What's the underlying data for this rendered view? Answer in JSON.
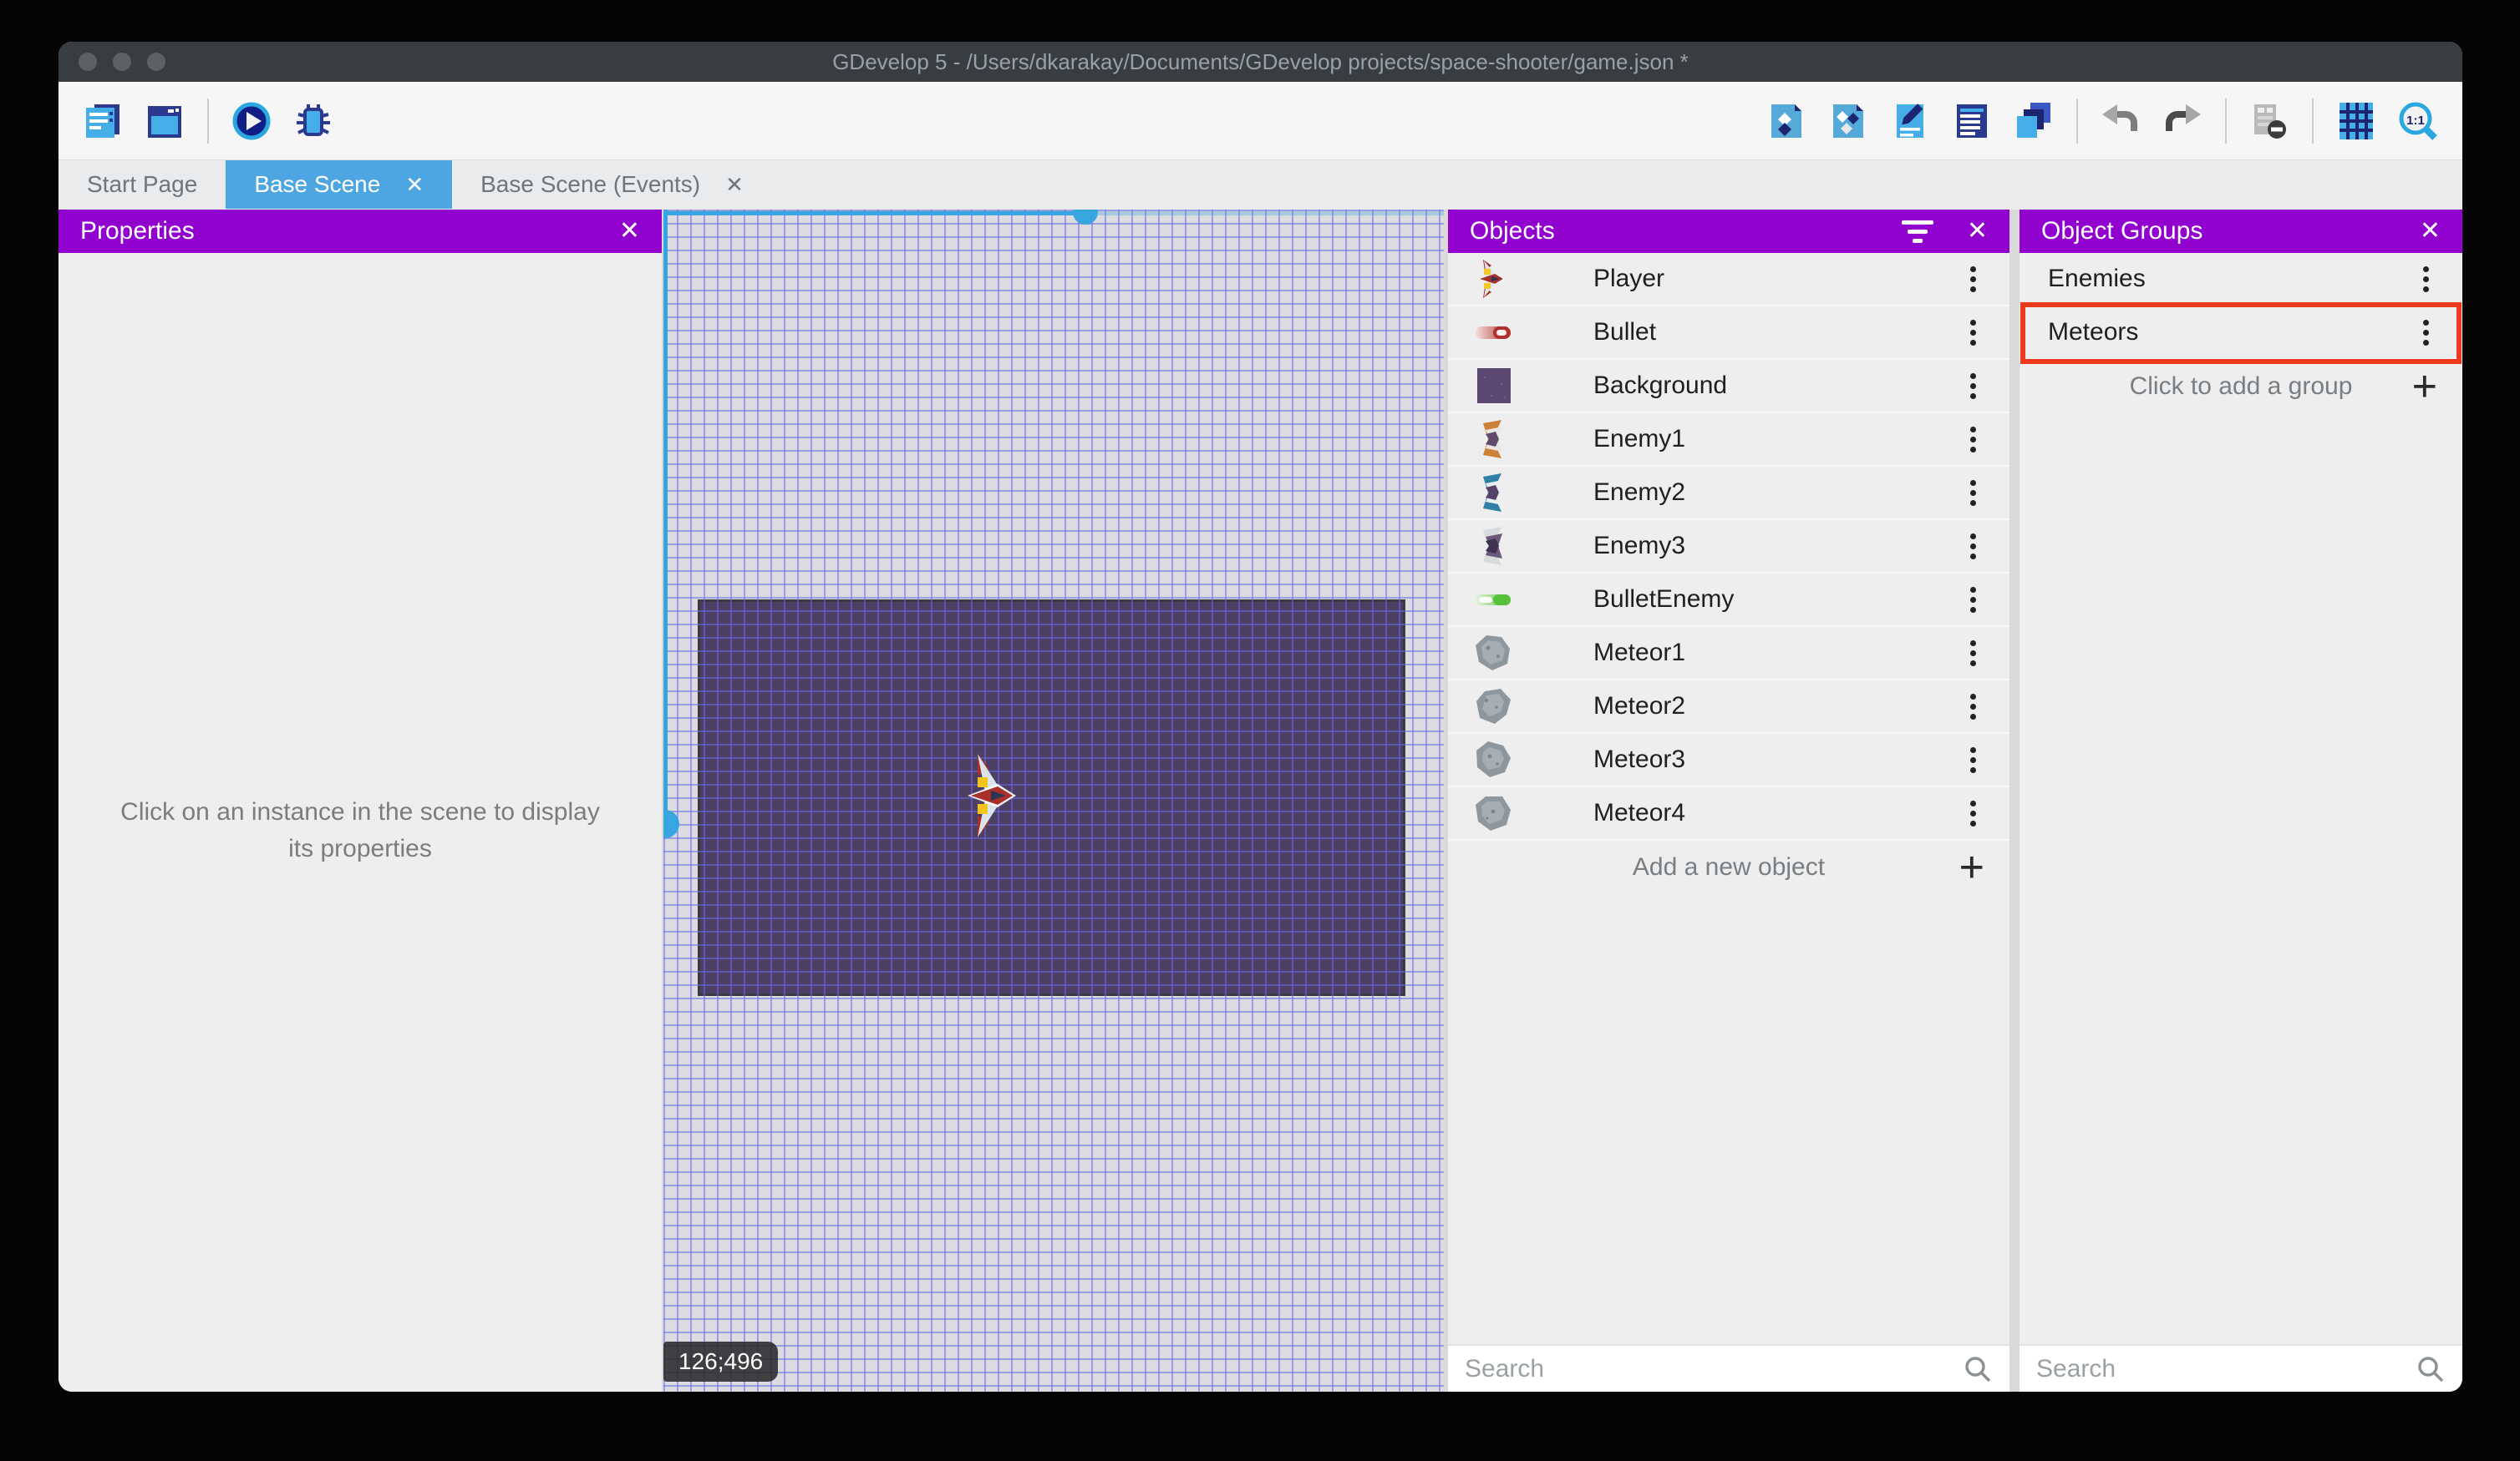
{
  "window": {
    "title": "GDevelop 5 - /Users/dkarakay/Documents/GDevelop projects/space-shooter/game.json *"
  },
  "toolbar": {
    "left_icons": [
      "project-manager-icon",
      "scene-editor-icon",
      "play-icon",
      "debug-icon"
    ],
    "right_icons": [
      "objects-editor-icon",
      "object-groups-icon",
      "properties-icon",
      "instances-list-icon",
      "layers-icon",
      "undo-icon",
      "redo-icon",
      "mask-icon",
      "grid-icon",
      "zoom-1-1-icon"
    ]
  },
  "tabs": [
    {
      "label": "Start Page",
      "active": false,
      "close": ""
    },
    {
      "label": "Base Scene",
      "active": true,
      "close": "✕"
    },
    {
      "label": "Base Scene (Events)",
      "active": false,
      "close": "✕"
    }
  ],
  "properties_panel": {
    "title": "Properties",
    "close_label": "✕",
    "message": "Click on an instance in the scene to display its properties"
  },
  "canvas": {
    "coordinates": "126;496"
  },
  "objects_panel": {
    "title": "Objects",
    "close_label": "✕",
    "items": [
      {
        "name": "Player",
        "icon": "icon-player"
      },
      {
        "name": "Bullet",
        "icon": "icon-bullet"
      },
      {
        "name": "Background",
        "icon": "icon-background"
      },
      {
        "name": "Enemy1",
        "icon": "icon-enemy1"
      },
      {
        "name": "Enemy2",
        "icon": "icon-enemy2"
      },
      {
        "name": "Enemy3",
        "icon": "icon-enemy3"
      },
      {
        "name": "BulletEnemy",
        "icon": "icon-bulletenemy"
      },
      {
        "name": "Meteor1",
        "icon": "icon-meteor1"
      },
      {
        "name": "Meteor2",
        "icon": "icon-meteor2"
      },
      {
        "name": "Meteor3",
        "icon": "icon-meteor3"
      },
      {
        "name": "Meteor4",
        "icon": "icon-meteor4"
      }
    ],
    "add_label": "Add a new object",
    "search_placeholder": "Search"
  },
  "groups_panel": {
    "title": "Object Groups",
    "close_label": "✕",
    "items": [
      {
        "name": "Enemies",
        "highlighted": false
      },
      {
        "name": "Meteors",
        "highlighted": true
      }
    ],
    "add_label": "Click to add a group",
    "search_placeholder": "Search"
  },
  "colors": {
    "header_purple": "#9102ce",
    "active_tab_blue": "#4da6e2",
    "highlight_red": "#ee3a1c",
    "scrollbar_blue": "#38a6de",
    "titlebar_dark": "#383d41"
  }
}
